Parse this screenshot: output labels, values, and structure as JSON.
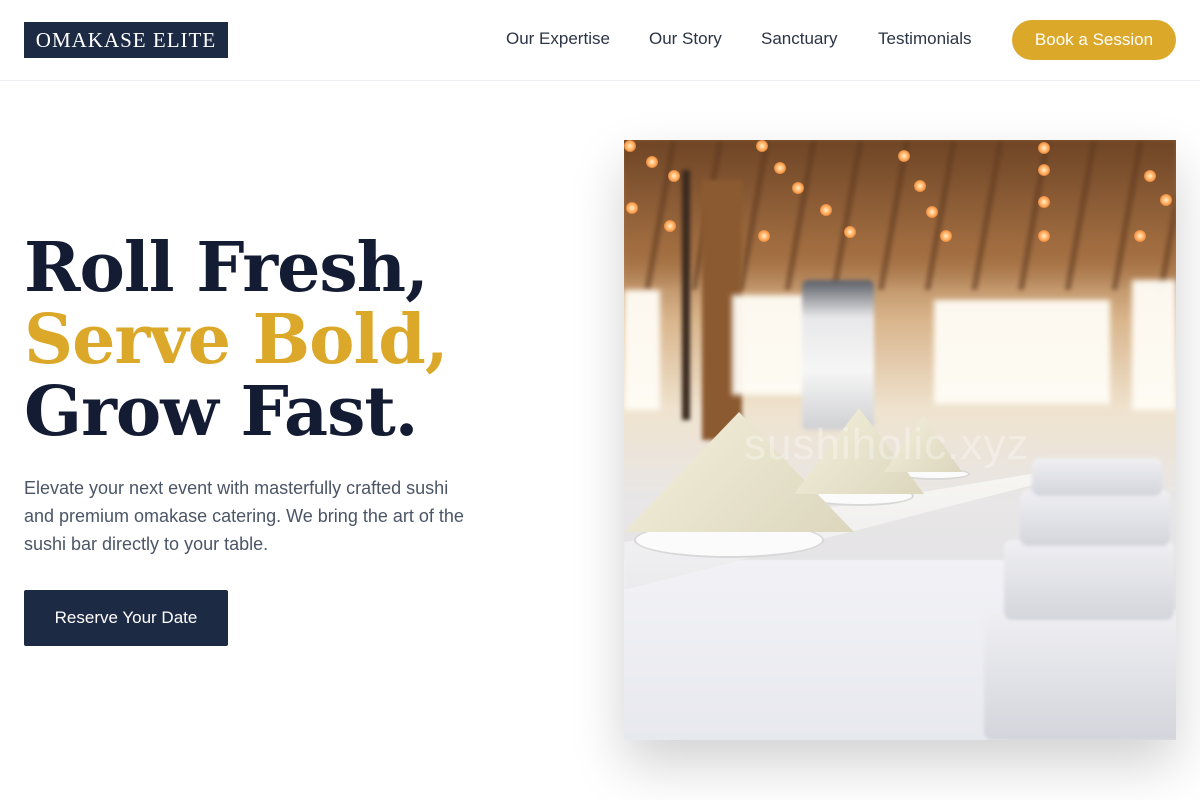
{
  "brand": {
    "logo_text": "OMAKASE ELITE"
  },
  "nav": {
    "items": [
      {
        "label": "Our Expertise"
      },
      {
        "label": "Our Story"
      },
      {
        "label": "Sanctuary"
      },
      {
        "label": "Testimonials"
      }
    ],
    "cta_label": "Book a Session"
  },
  "hero": {
    "headline_line1": "Roll Fresh,",
    "headline_line2": "Serve Bold,",
    "headline_line3": "Grow Fast.",
    "subtext": "Elevate your next event with masterfully crafted sushi and premium omakase catering. We bring the art of the sushi bar directly to your table.",
    "cta_label": "Reserve Your Date",
    "image_watermark": "sushiholic.xyz"
  },
  "colors": {
    "navy": "#1d2a44",
    "gold": "#dca829",
    "headline": "#131c33",
    "body_text": "#4b5566"
  }
}
